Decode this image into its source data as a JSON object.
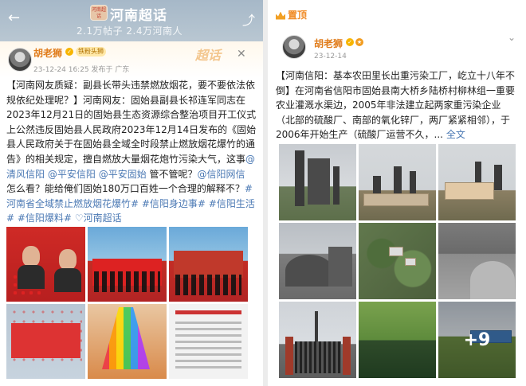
{
  "left": {
    "header": {
      "title": "河南超话",
      "logo_text": "河南超话",
      "stats": "2.1万帖子 2.4万河南人"
    },
    "post": {
      "author": "胡老狮",
      "fan_badge": "铁粉头狮",
      "meta": "23-12-24 16:25  发布于 广东",
      "text": "【河南网友质疑：副县长带头违禁燃放烟花，要不要依法依规依纪处理呢？】河南网友：固始县副县长祁连军同志在2023年12月21日的固始县生态资源综合整治项目开工仪式上公然违反固始县人民政府2023年12月14日发布的《固始县人民政府关于在固始县全域全时段禁止燃放烟花爆竹的通告》的相关规定，擅自燃放大量烟花炮竹污染大气，这事",
      "mention_1": "@清风信阳",
      "mention_2": "@平安信阳",
      "mention_3": "@平安固始",
      "text_2": " 管不管呢？",
      "mention_4": "@信阳网信",
      "text_3": " 怎么看？能给俺们固始180万口百姓一个合理的解释不？",
      "hashtags": "#河南省全域禁止燃放烟花爆竹# #信阳身边事# #信阳生活# #信阳爆料# ",
      "topic": "河南超话",
      "chaohua_label": "超话"
    }
  },
  "right": {
    "pinned_label": "置顶",
    "post": {
      "author": "胡老狮",
      "date": "23-12-14",
      "text": "【河南信阳：基本农田里长出重污染工厂，屹立十八年不倒】在河南省信阳市固始县南大桥乡陆桥村柳林组一重要农业灌溉水渠边，2005年非法建立起两家重污染企业（北部的硫酸厂、南部的氧化锌厂，两厂紧紧相邻），于2006年开始生产（硫酸厂运营不久，... ",
      "more": "全文",
      "more_count": "+9"
    }
  },
  "colors": {
    "link": "#4b79b4",
    "author": "#e07c1b"
  }
}
